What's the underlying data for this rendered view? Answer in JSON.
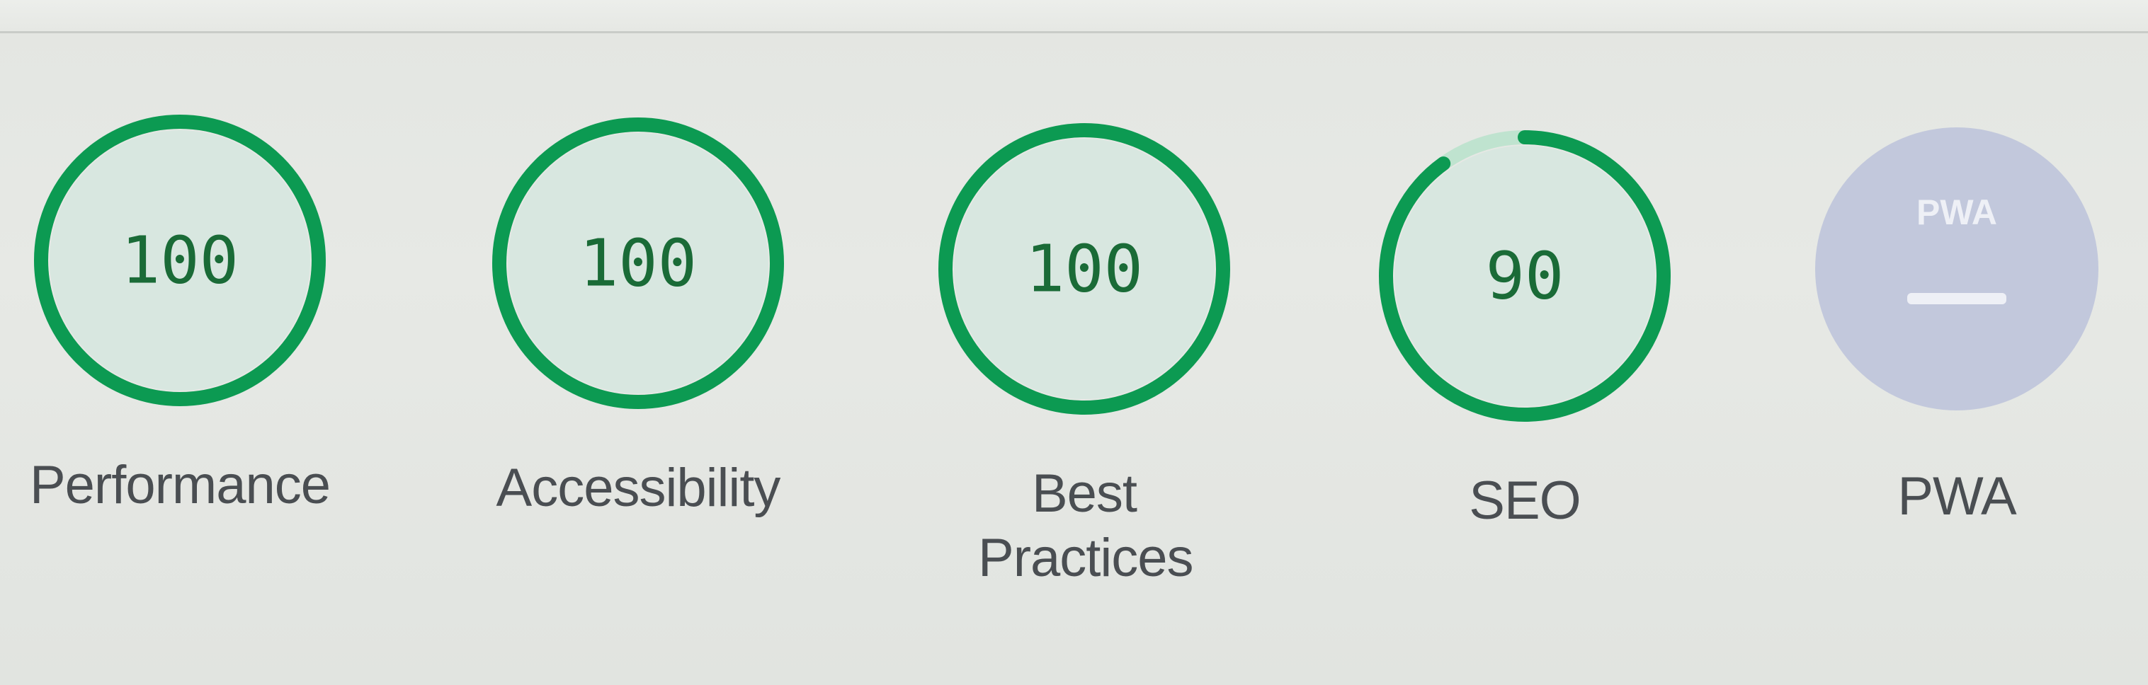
{
  "colors": {
    "pass": "#0c9a52",
    "track": "#bfe3cf",
    "fill": "#d8e7e0",
    "score_text": "#1a6b37",
    "pwa_fill": "#c2c8dc",
    "label": "#4a4e52"
  },
  "gauges": [
    {
      "label": "Performance",
      "score": 100,
      "value": "100"
    },
    {
      "label": "Accessibility",
      "score": 100,
      "value": "100"
    },
    {
      "label": "Best Practices",
      "score": 100,
      "value": "100"
    },
    {
      "label": "SEO",
      "score": 90,
      "value": "90"
    }
  ],
  "pwa": {
    "label": "PWA",
    "badge_text": "PWA",
    "icon": "pwa-badge-icon"
  }
}
